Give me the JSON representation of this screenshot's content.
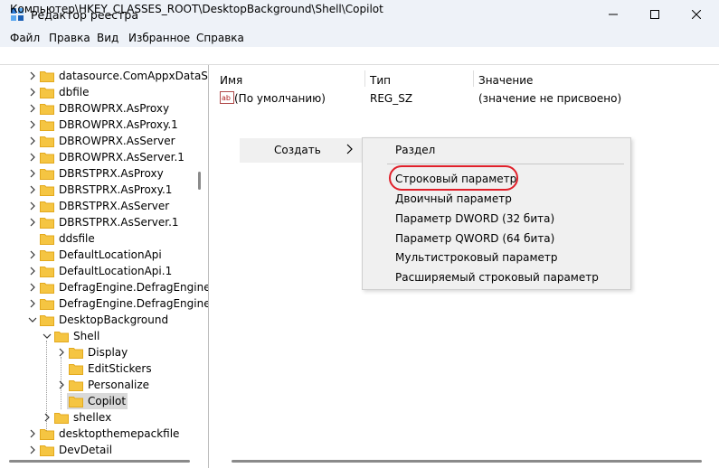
{
  "window": {
    "title": "Редактор реестра",
    "controls": {
      "minimize": "minimize-icon",
      "maximize": "maximize-icon",
      "close": "close-icon"
    }
  },
  "menu": [
    "Файл",
    "Правка",
    "Вид",
    "Избранное",
    "Справка"
  ],
  "address": "Компьютер\\HKEY_CLASSES_ROOT\\DesktopBackground\\Shell\\Copilot",
  "tree": [
    {
      "label": "datasource.ComAppxDataSo",
      "level": 0,
      "expander": "collapsed"
    },
    {
      "label": "dbfile",
      "level": 0,
      "expander": "collapsed"
    },
    {
      "label": "DBROWPRX.AsProxy",
      "level": 0,
      "expander": "collapsed"
    },
    {
      "label": "DBROWPRX.AsProxy.1",
      "level": 0,
      "expander": "collapsed"
    },
    {
      "label": "DBROWPRX.AsServer",
      "level": 0,
      "expander": "collapsed"
    },
    {
      "label": "DBROWPRX.AsServer.1",
      "level": 0,
      "expander": "collapsed"
    },
    {
      "label": "DBRSTPRX.AsProxy",
      "level": 0,
      "expander": "collapsed"
    },
    {
      "label": "DBRSTPRX.AsProxy.1",
      "level": 0,
      "expander": "collapsed"
    },
    {
      "label": "DBRSTPRX.AsServer",
      "level": 0,
      "expander": "collapsed"
    },
    {
      "label": "DBRSTPRX.AsServer.1",
      "level": 0,
      "expander": "collapsed"
    },
    {
      "label": "ddsfile",
      "level": 0,
      "expander": "none"
    },
    {
      "label": "DefaultLocationApi",
      "level": 0,
      "expander": "collapsed"
    },
    {
      "label": "DefaultLocationApi.1",
      "level": 0,
      "expander": "collapsed"
    },
    {
      "label": "DefragEngine.DefragEngine",
      "level": 0,
      "expander": "collapsed"
    },
    {
      "label": "DefragEngine.DefragEngine.",
      "level": 0,
      "expander": "collapsed"
    },
    {
      "label": "DesktopBackground",
      "level": 0,
      "expander": "expanded"
    },
    {
      "label": "Shell",
      "level": 1,
      "expander": "expanded"
    },
    {
      "label": "Display",
      "level": 2,
      "expander": "collapsed"
    },
    {
      "label": "EditStickers",
      "level": 2,
      "expander": "none"
    },
    {
      "label": "Personalize",
      "level": 2,
      "expander": "collapsed"
    },
    {
      "label": "Copilot",
      "level": 2,
      "expander": "none",
      "selected": true
    },
    {
      "label": "shellex",
      "level": 1,
      "expander": "collapsed"
    },
    {
      "label": "desktopthemepackfile",
      "level": 0,
      "expander": "collapsed"
    },
    {
      "label": "DevDetail",
      "level": 0,
      "expander": "collapsed"
    }
  ],
  "values": {
    "headers": {
      "name": "Имя",
      "type": "Тип",
      "data": "Значение"
    },
    "rows": [
      {
        "icon": "string-value-icon",
        "name": "(По умолчанию)",
        "type": "REG_SZ",
        "data": "(значение не присвоено)"
      }
    ]
  },
  "context_menu": {
    "create": "Создать",
    "submenu": [
      "Раздел",
      "Строковый параметр",
      "Двоичный параметр",
      "Параметр DWORD (32 бита)",
      "Параметр QWORD (64 бита)",
      "Мультистроковый параметр",
      "Расширяемый строковый параметр"
    ],
    "highlighted": "Строковый параметр"
  },
  "colors": {
    "folder": "#f5c542",
    "folder_dark": "#e3a91d",
    "highlight_ring": "#e0202a",
    "title_bg": "#eef2f8",
    "menu_bg": "#f0f0f0"
  }
}
